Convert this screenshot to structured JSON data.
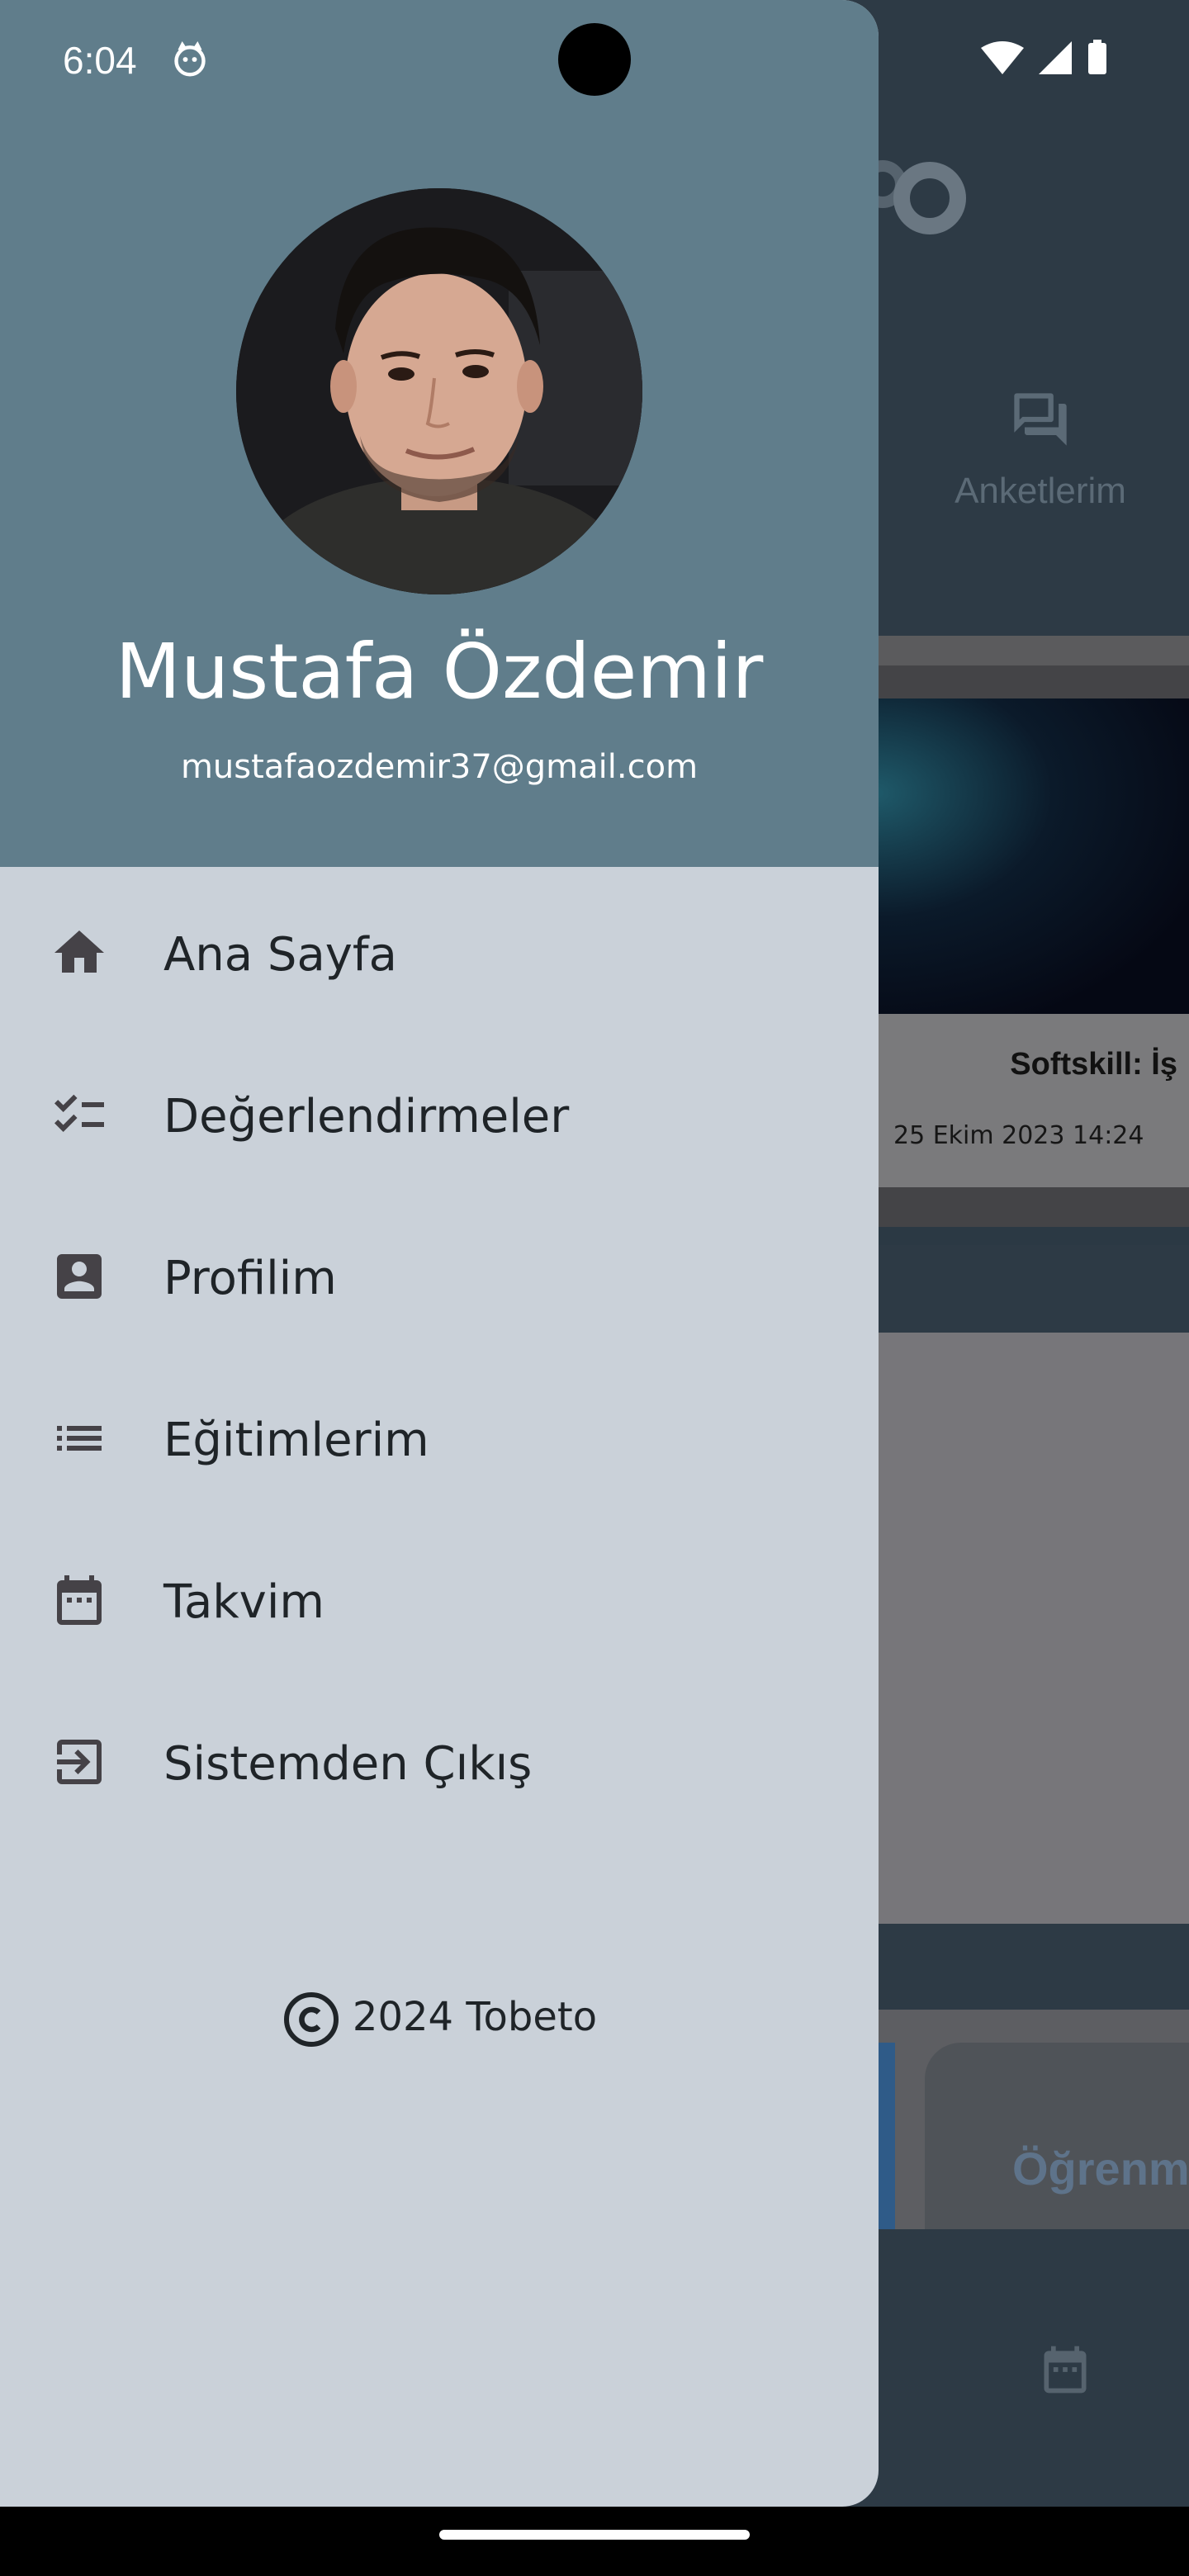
{
  "status_bar": {
    "time": "6:04"
  },
  "user": {
    "name": "Mustafa Özdemir",
    "email": "mustafaozdemir37@gmail.com"
  },
  "menu": {
    "items": [
      {
        "label": "Ana Sayfa",
        "icon": "home-icon"
      },
      {
        "label": "Değerlendirmeler",
        "icon": "checklist-icon"
      },
      {
        "label": "Profilim",
        "icon": "profile-icon"
      },
      {
        "label": "Eğitimlerim",
        "icon": "list-icon"
      },
      {
        "label": "Takvim",
        "icon": "calendar-icon"
      },
      {
        "label": "Sistemden Çıkış",
        "icon": "logout-icon"
      }
    ]
  },
  "footer": {
    "copyright": "2024 Tobeto"
  },
  "background": {
    "survey_label": "Anketlerim",
    "card_title": "Softskill: İş",
    "card_date": "25 Ekim 2023 14:24",
    "tile_text": "Öğrenm"
  },
  "colors": {
    "drawer_header": "#607d8b",
    "drawer_body": "#cad1d9",
    "app_dark": "#2d3a45"
  }
}
